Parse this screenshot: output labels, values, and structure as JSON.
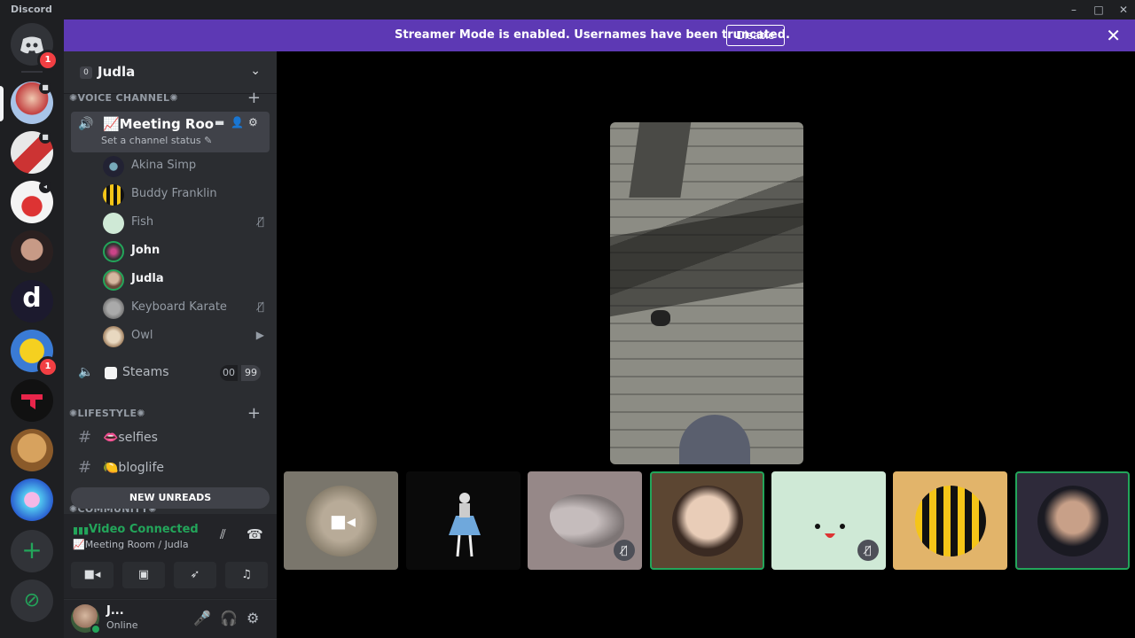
{
  "window": {
    "app_name": "Discord",
    "minimize": "–",
    "maximize": "□",
    "close": "✕"
  },
  "server_rail": {
    "home_badge": "1",
    "adhu_badge": "1",
    "dsymbol_label": "d",
    "add_server": "+",
    "explore": "⊘"
  },
  "banner": {
    "message": "Streamer Mode is enabled. Usernames have been truncated.",
    "button": "Disable",
    "close": "✕"
  },
  "guild": {
    "count": "0",
    "name": "Judla",
    "chevron": "⌄"
  },
  "categories": {
    "voice": "✺VOICE CHANNEL✺",
    "lifestyle": "✺LIFESTYLE✺",
    "community": "✺COMMUNITY✺",
    "plus": "+"
  },
  "active_voice_channel": {
    "name": "📈Meeting Roo...",
    "status": "Set a channel status ✎",
    "speaker_icon": "🔊"
  },
  "voice_members": [
    {
      "name": "Akina Simp",
      "status_icon": ""
    },
    {
      "name": "Buddy Franklin",
      "status_icon": ""
    },
    {
      "name": "Fish",
      "status_icon": "🎙̸"
    },
    {
      "name": "John",
      "status_icon": ""
    },
    {
      "name": "Judla",
      "status_icon": ""
    },
    {
      "name": "Keyboard Karate",
      "status_icon": "🎙̸"
    },
    {
      "name": "Owl",
      "status_icon": "▶"
    }
  ],
  "steams_channel": {
    "name": "Steams",
    "count_a": "00",
    "count_b": "99"
  },
  "text_channels": [
    {
      "name": "👄selfies"
    },
    {
      "name": "🍋bloglife"
    }
  ],
  "new_unreads": "NEW UNREADS",
  "rtc": {
    "status": "Video Connected",
    "location": "📈Meeting Room / Judla",
    "bars": "▮▮▮"
  },
  "user": {
    "name": "J...",
    "status": "Online"
  },
  "colors": {
    "banner": "#5d39b4",
    "connected": "#23a55a",
    "badge": "#f23f43"
  }
}
